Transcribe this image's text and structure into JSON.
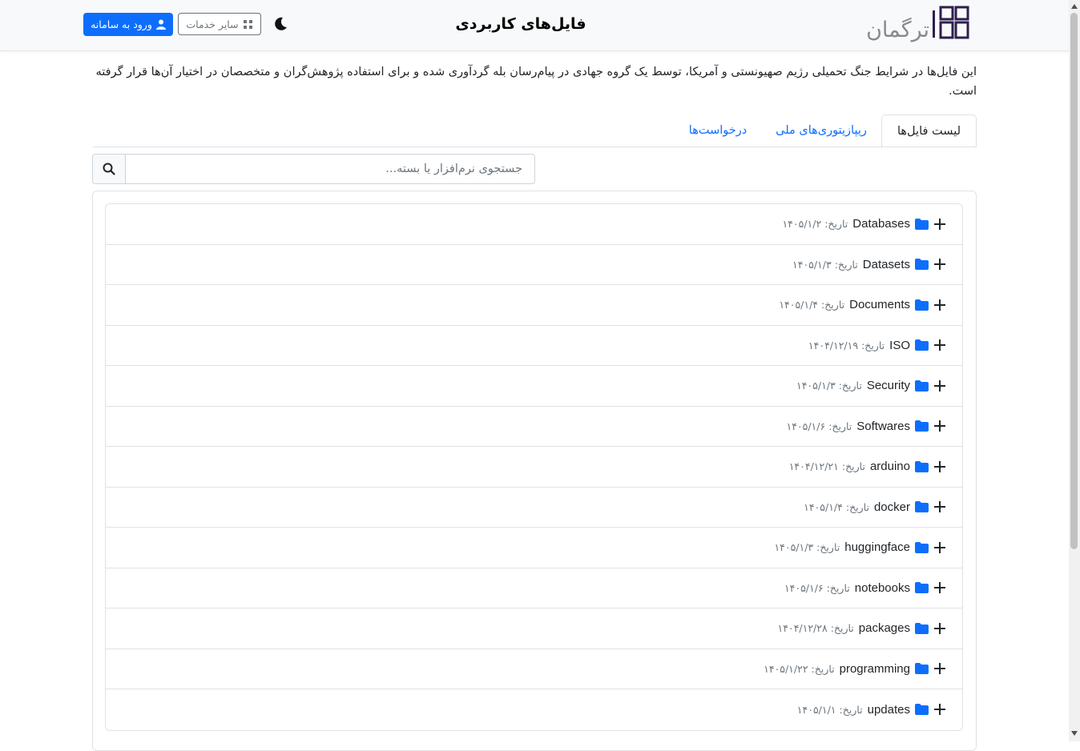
{
  "header": {
    "logo_text": "ترگمان",
    "title": "فایل‌های کاربردی",
    "services_label": "سایر خدمات",
    "login_label": "ورود به سامانه"
  },
  "intro": "این فایل‌ها در شرایط جنگ تحمیلی رژیم صهیونستی و آمریکا، توسط یک گروه جهادی در پیام‌رسان بله گردآوری شده و برای استفاده پژوهش‌گران و متخصصان در اختیار آن‌ها قرار گرفته است.",
  "tabs": [
    {
      "label": "لیست فایل‌ها",
      "active": true
    },
    {
      "label": "ریپازیتوری‌های ملی",
      "active": false
    },
    {
      "label": "درخواست‌ها",
      "active": false
    }
  ],
  "search": {
    "placeholder": "جستجوی نرم‌افزار یا بسته..."
  },
  "date_label": "تاریخ:",
  "files": [
    {
      "name": "Databases",
      "date": "۱۴۰۵/۱/۲"
    },
    {
      "name": "Datasets",
      "date": "۱۴۰۵/۱/۳"
    },
    {
      "name": "Documents",
      "date": "۱۴۰۵/۱/۴"
    },
    {
      "name": "ISO",
      "date": "۱۴۰۴/۱۲/۱۹"
    },
    {
      "name": "Security",
      "date": "۱۴۰۵/۱/۳"
    },
    {
      "name": "Softwares",
      "date": "۱۴۰۵/۱/۶"
    },
    {
      "name": "arduino",
      "date": "۱۴۰۴/۱۲/۲۱"
    },
    {
      "name": "docker",
      "date": "۱۴۰۵/۱/۴"
    },
    {
      "name": "huggingface",
      "date": "۱۴۰۵/۱/۳"
    },
    {
      "name": "notebooks",
      "date": "۱۴۰۵/۱/۶"
    },
    {
      "name": "packages",
      "date": "۱۴۰۴/۱۲/۲۸"
    },
    {
      "name": "programming",
      "date": "۱۴۰۵/۱/۲۲"
    },
    {
      "name": "updates",
      "date": "۱۴۰۵/۱/۱"
    }
  ],
  "colors": {
    "primary": "#0d6efd",
    "logo_mark": "#2e1f4f",
    "logo_text": "#8a8a8a",
    "folder": "#0d6efd"
  }
}
